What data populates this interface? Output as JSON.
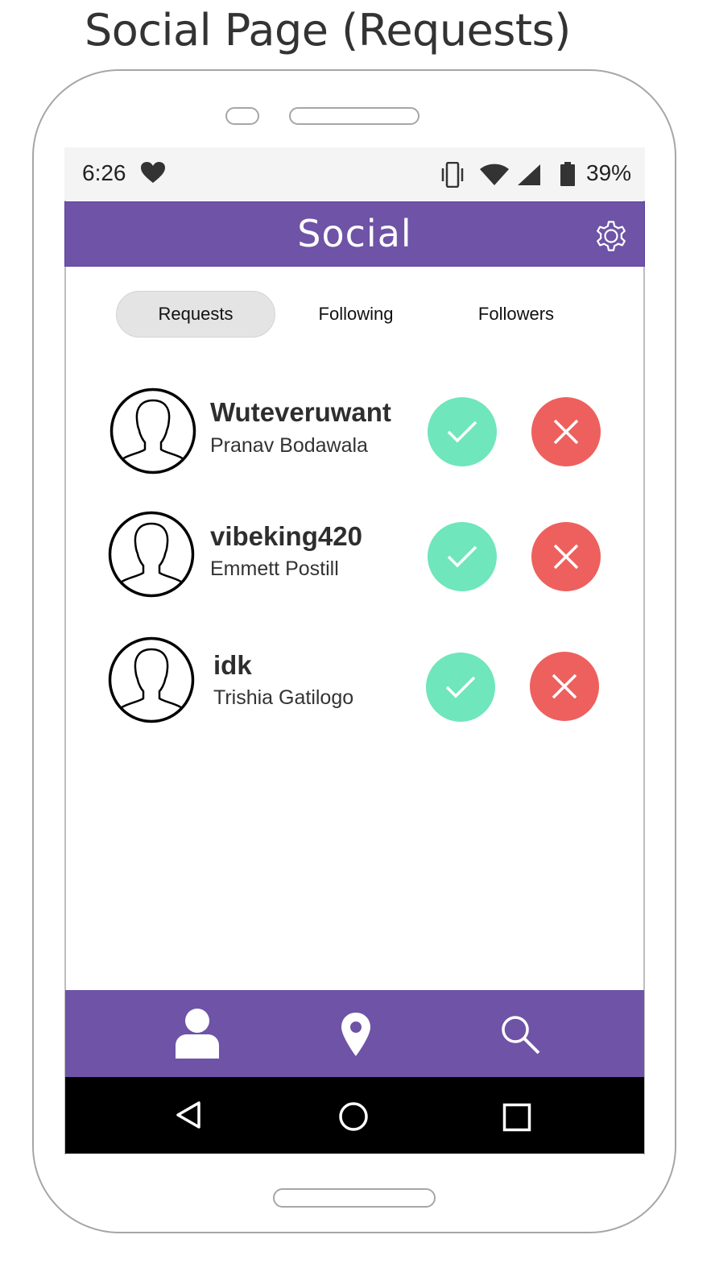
{
  "page_title": "Social Page (Requests)",
  "status_bar": {
    "time": "6:26",
    "battery": "39%",
    "icons": [
      "heart-icon",
      "vibrate-icon",
      "wifi-icon",
      "signal-icon",
      "battery-icon"
    ]
  },
  "app_bar": {
    "title": "Social",
    "settings_icon": "gear-icon"
  },
  "tabs": [
    {
      "label": "Requests",
      "active": true
    },
    {
      "label": "Following",
      "active": false
    },
    {
      "label": "Followers",
      "active": false
    }
  ],
  "requests": [
    {
      "username": "Wuteveruwant",
      "name": "Pranav Bodawala"
    },
    {
      "username": "vibeking420",
      "name": "Emmett Postill"
    },
    {
      "username": "idk",
      "name": "Trishia Gatilogo"
    }
  ],
  "bottom_nav": {
    "items": [
      "profile-icon",
      "location-pin-icon",
      "search-icon"
    ]
  },
  "system_nav": {
    "items": [
      "back-icon",
      "home-icon",
      "recents-icon"
    ]
  },
  "colors": {
    "primary": "#6e53a7",
    "accept": "#6fe6bb",
    "decline": "#ed605e",
    "active_tab": "#e4e4e4"
  }
}
